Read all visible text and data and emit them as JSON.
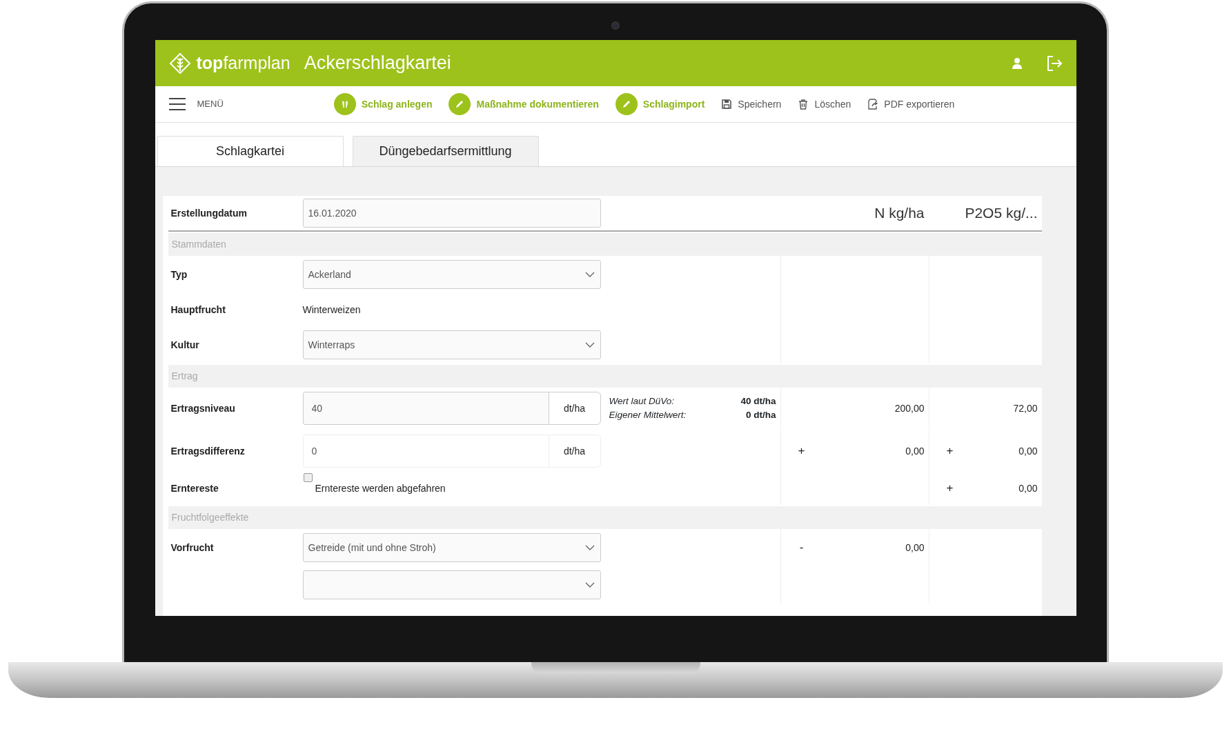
{
  "header": {
    "logo": "**top**farmplan",
    "title": "Ackerschlagkartei"
  },
  "toolbar": {
    "menu_label": "MENÜ",
    "actions": [
      {
        "label": "Schlag anlegen",
        "kind": "primary"
      },
      {
        "label": "Maßnahme dokumentieren",
        "kind": "primary"
      },
      {
        "label": "Schlagimport",
        "kind": "primary"
      },
      {
        "label": "Speichern",
        "kind": "plain"
      },
      {
        "label": "Löschen",
        "kind": "plain"
      },
      {
        "label": "PDF exportieren",
        "kind": "plain"
      }
    ]
  },
  "tabs": [
    {
      "label": "Schlagkartei",
      "selected": false
    },
    {
      "label": "Düngebedarfsermittlung",
      "selected": true
    }
  ],
  "form": {
    "date_label": "Erstellungdatum",
    "date_value": "16.01.2020",
    "columns": [
      "N kg/ha",
      "P2O5 kg/..."
    ],
    "rows": [
      {
        "kind": "section",
        "label": "Stammdaten"
      },
      {
        "kind": "select",
        "label": "Typ",
        "value": "Ackerland"
      },
      {
        "kind": "text",
        "label": "Hauptfrucht",
        "value": "Winterweizen"
      },
      {
        "kind": "select",
        "label": "Kultur",
        "value": "Winterraps"
      },
      {
        "kind": "section",
        "label": "Ertrag"
      },
      {
        "kind": "unit_input",
        "label": "Ertragsniveau",
        "value": "40",
        "unit": "dt/ha",
        "readonly": true,
        "notes": [
          {
            "label": "Wert laut DüVo:",
            "value": "40 dt/ha"
          },
          {
            "label": "Eigener Mittelwert:",
            "value": "0 dt/ha"
          }
        ],
        "n": {
          "value": "200,00"
        },
        "p": {
          "value": "72,00"
        }
      },
      {
        "kind": "unit_input",
        "label": "Ertragsdifferenz",
        "value": "0",
        "unit": "dt/ha",
        "readonly": false,
        "n": {
          "sign": "+",
          "value": "0,00"
        },
        "p": {
          "sign": "+",
          "value": "0,00"
        }
      },
      {
        "kind": "checkbox",
        "label": "Erntereste",
        "text": "Erntereste werden abgefahren",
        "checked": false,
        "p": {
          "sign": "+",
          "value": "0,00"
        }
      },
      {
        "kind": "section",
        "label": "Fruchtfolgeeffekte"
      },
      {
        "kind": "select",
        "label": "Vorfrucht",
        "value": "Getreide (mit und ohne Stroh)",
        "n": {
          "sign": "-",
          "value": "0,00"
        }
      },
      {
        "kind": "select"
      }
    ]
  }
}
